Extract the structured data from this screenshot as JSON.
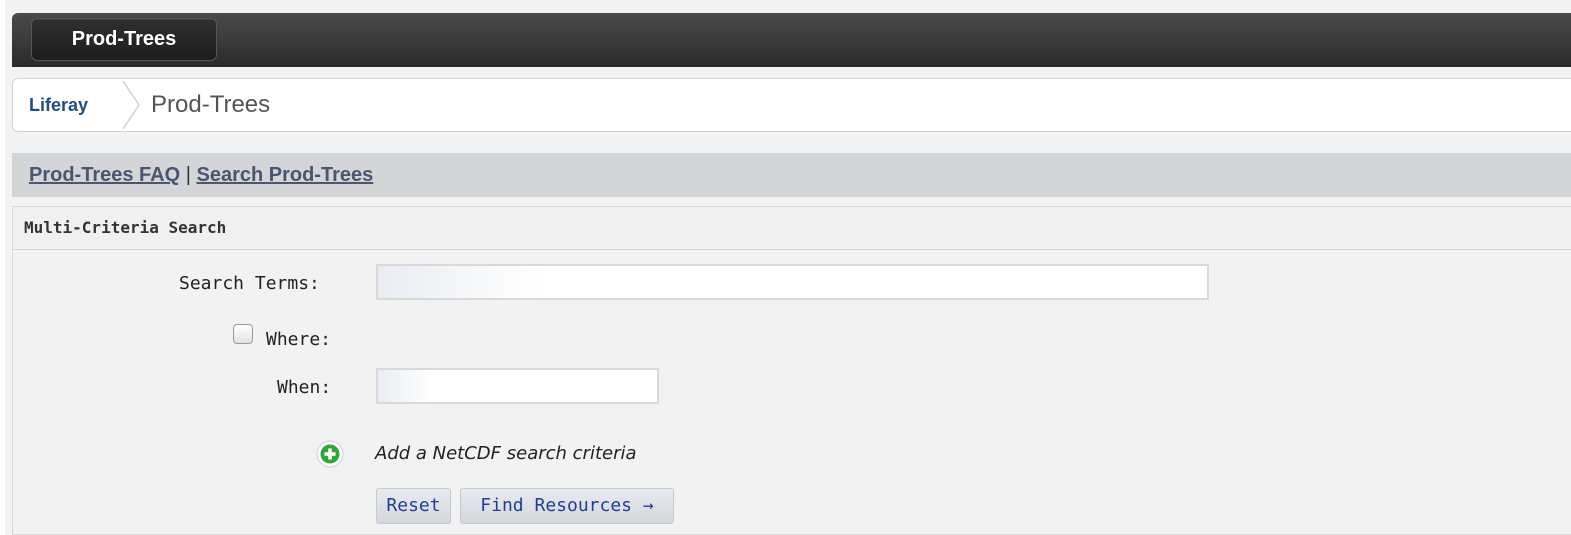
{
  "site": {
    "tab_label": "Prod-Trees"
  },
  "breadcrumb": {
    "root": "Liferay",
    "current": "Prod-Trees"
  },
  "links": {
    "faq": "Prod-Trees FAQ",
    "separator": "|",
    "search": "Search Prod-Trees"
  },
  "panel": {
    "title": "Multi-Criteria Search"
  },
  "form": {
    "search_terms_label": "Search Terms:",
    "search_terms_value": "",
    "where_label": "Where:",
    "where_checked": false,
    "when_label": "When:",
    "when_value": "",
    "add_criteria_label": "Add a NetCDF search criteria"
  },
  "buttons": {
    "reset": "Reset",
    "find": "Find Resources →"
  },
  "colors": {
    "topbar": "#333333",
    "link": "#1f4f82",
    "button_text": "#1f3f8f",
    "add_icon": "#2fa83a"
  },
  "icons": {
    "add": "plus-circle-icon",
    "breadcrumb_sep": "chevron-right-icon"
  }
}
